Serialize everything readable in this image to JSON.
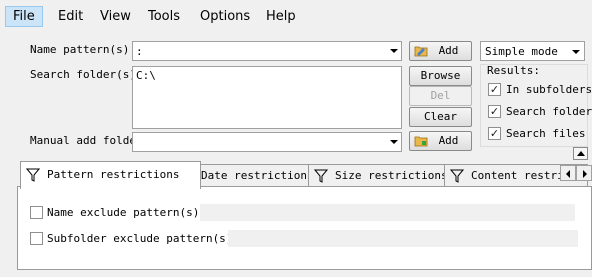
{
  "menu": {
    "items": [
      {
        "label": "File",
        "active": true
      },
      {
        "label": "Edit",
        "active": false
      },
      {
        "label": "View",
        "active": false
      },
      {
        "label": "Tools",
        "active": false
      },
      {
        "label": "Options",
        "active": false
      },
      {
        "label": "Help",
        "active": false
      }
    ]
  },
  "search": {
    "name_pattern_label": "Name pattern(s):",
    "name_pattern_value": ":",
    "search_folder_label": "Search folder(s):",
    "search_folder_value": "C:\\",
    "manual_add_label": "Manual add folder",
    "manual_add_value": ""
  },
  "buttons": {
    "add_top": "Add",
    "browse": "Browse",
    "del": "Del",
    "clear": "Clear",
    "add_bottom": "Add"
  },
  "mode": {
    "value": "Simple mode"
  },
  "results": {
    "label": "Results:",
    "in_subfolders": {
      "label": "In subfolders",
      "checked": true
    },
    "search_folders": {
      "label": "Search folders",
      "checked": true
    },
    "search_files": {
      "label": "Search files",
      "checked": true
    }
  },
  "tabs": [
    {
      "label": "Pattern restrictions",
      "active": true
    },
    {
      "label": "Date restrictions",
      "active": false
    },
    {
      "label": "Size restrictions",
      "active": false
    },
    {
      "label": "Content restrictions",
      "active": false
    }
  ],
  "pattern_tab": {
    "name_exclude": {
      "label": "Name exclude pattern(s):",
      "checked": false
    },
    "subfolder_exclude": {
      "label": "Subfolder exclude pattern(s):",
      "checked": false
    }
  },
  "icons": {
    "add": "add-folder-icon",
    "tab": "funnel-icon",
    "collapse": "collapse-up-icon",
    "scroll_left": "left-arrow-icon",
    "scroll_right": "right-arrow-icon"
  }
}
